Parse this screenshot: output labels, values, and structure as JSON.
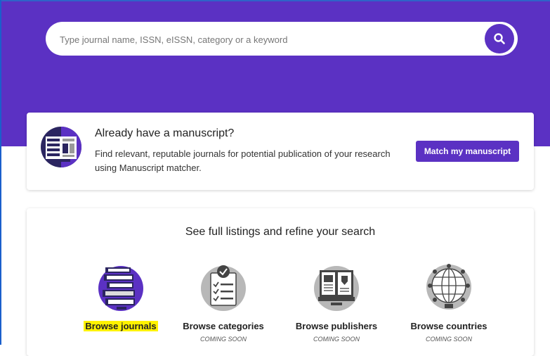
{
  "colors": {
    "brand_purple": "#5b31c3",
    "highlight": "#fff200",
    "text_dark": "#222222"
  },
  "search": {
    "placeholder": "Type journal name, ISSN, eISSN, category or a keyword",
    "icon": "search-icon"
  },
  "manuscript": {
    "icon": "manuscript-icon",
    "title": "Already have a manuscript?",
    "description": "Find relevant, reputable journals for potential publication of your research using Manuscript matcher.",
    "button_label": "Match my manuscript"
  },
  "browse": {
    "title": "See full listings and refine your search",
    "items": [
      {
        "label": "Browse journals",
        "status": "",
        "icon": "journals-icon",
        "highlighted": true
      },
      {
        "label": "Browse categories",
        "status": "COMING SOON",
        "icon": "categories-icon",
        "highlighted": false
      },
      {
        "label": "Browse publishers",
        "status": "COMING SOON",
        "icon": "publishers-icon",
        "highlighted": false
      },
      {
        "label": "Browse countries",
        "status": "COMING SOON",
        "icon": "countries-icon",
        "highlighted": false
      }
    ]
  }
}
